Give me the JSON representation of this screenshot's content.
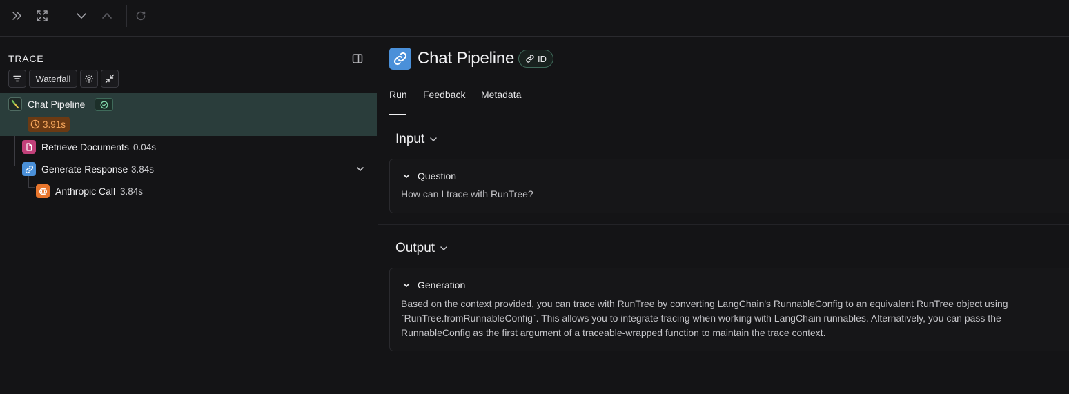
{
  "toolbar": {
    "icons": [
      "double-chevron-right-icon",
      "expand-icon",
      "chevron-down-icon",
      "chevron-up-icon",
      "refresh-icon"
    ]
  },
  "trace_panel": {
    "title": "TRACE",
    "view_mode": "Waterfall",
    "tree": [
      {
        "label": "Chat Pipeline",
        "latency": "3.91s",
        "status": "success",
        "icon": "chain-icon",
        "selected": true
      },
      {
        "label": "Retrieve Documents",
        "latency": "0.04s",
        "icon": "document-icon",
        "color": "#c2407a"
      },
      {
        "label": "Generate Response",
        "latency": "3.84s",
        "icon": "link-icon",
        "color": "#4a90d9",
        "expanded": true
      },
      {
        "label": "Anthropic Call",
        "latency": "3.84s",
        "icon": "llm-icon",
        "color": "#e8762d"
      }
    ]
  },
  "run": {
    "title": "Chat Pipeline",
    "id_label": "ID",
    "tabs": [
      "Run",
      "Feedback",
      "Metadata"
    ],
    "active_tab": "Run",
    "input": {
      "heading": "Input",
      "field_label": "Question",
      "value": "How can I trace with RunTree?"
    },
    "output": {
      "heading": "Output",
      "field_label": "Generation",
      "lines": [
        "Based on the context provided, you can trace with RunTree by converting LangChain's RunnableConfig to an equivalent RunTree object using",
        "`RunTree.fromRunnableConfig`. This allows you to integrate tracing when working with LangChain runnables. Alternatively, you can pass the",
        "RunnableConfig as the first argument of a traceable-wrapped function to maintain the trace context."
      ]
    }
  },
  "colors": {
    "background": "#141416",
    "selected_row": "#2a3d3b",
    "run_accent": "#4a90d9",
    "latency_bg": "#6b3a13",
    "latency_fg": "#f6a65b",
    "success": "#7fd4a8"
  }
}
